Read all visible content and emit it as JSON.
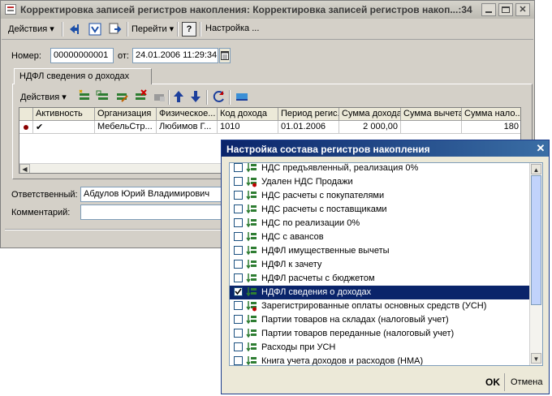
{
  "main_window": {
    "title": "Корректировка записей регистров накопления: Корректировка записей регистров накоп...:34",
    "title_controls": [
      "_",
      "□",
      "✕"
    ],
    "toolbar": {
      "actions": "Действия",
      "goto": "Перейти",
      "help": "?",
      "settings": "Настройка ..."
    },
    "number_label": "Номер:",
    "number_value": "00000000001",
    "date_label": "от:",
    "date_value": "24.01.2006 11:29:34",
    "tab_label": "НДФЛ сведения о доходах",
    "grid_toolbar": {
      "actions": "Действия"
    },
    "grid": {
      "columns": [
        "Активность",
        "Организация",
        "Физическое...",
        "Код дохода",
        "Период регис...",
        "Сумма дохода",
        "Сумма вычета",
        "Сумма нало..."
      ],
      "rows": [
        {
          "active": "✔",
          "org": "МебельСтр...",
          "person": "Любимов Г...",
          "code": "1010",
          "period": "01.01.2006",
          "income": "2 000,00",
          "deduction": "",
          "tax": "180"
        }
      ]
    },
    "responsible_label": "Ответственный:",
    "responsible_value": "Абдулов Юрий Владимирович",
    "comment_label": "Комментарий:",
    "comment_value": ""
  },
  "dialog": {
    "title": "Настройка состава регистров накопления",
    "close": "✕",
    "items": [
      {
        "label": "НДС предъявленный, реализация 0%",
        "checked": false,
        "deleted": false
      },
      {
        "label": "Удален НДС Продажи",
        "checked": false,
        "deleted": true
      },
      {
        "label": "НДС расчеты с покупателями",
        "checked": false,
        "deleted": false
      },
      {
        "label": "НДС расчеты с поставщиками",
        "checked": false,
        "deleted": false
      },
      {
        "label": "НДС по реализации 0%",
        "checked": false,
        "deleted": false
      },
      {
        "label": "НДС с авансов",
        "checked": false,
        "deleted": false
      },
      {
        "label": "НДФЛ имущественные вычеты",
        "checked": false,
        "deleted": false
      },
      {
        "label": "НДФЛ к зачету",
        "checked": false,
        "deleted": false
      },
      {
        "label": "НДФЛ расчеты с бюджетом",
        "checked": false,
        "deleted": false
      },
      {
        "label": "НДФЛ сведения о доходах",
        "checked": true,
        "deleted": false,
        "selected": true
      },
      {
        "label": "Зарегистрированные оплаты основных средств (УСН)",
        "checked": false,
        "deleted": true
      },
      {
        "label": "Партии товаров на складах (налоговый учет)",
        "checked": false,
        "deleted": false
      },
      {
        "label": "Партии товаров переданные (налоговый учет)",
        "checked": false,
        "deleted": false
      },
      {
        "label": "Расходы при УСН",
        "checked": false,
        "deleted": false
      },
      {
        "label": "Книга учета доходов и расходов (НМА)",
        "checked": false,
        "deleted": false
      }
    ],
    "ok": "OK",
    "cancel": "Отмена"
  },
  "colors": {
    "dialog_title": "#0a246a",
    "selection": "#0a246a",
    "window_bg": "#d4d0c8"
  }
}
